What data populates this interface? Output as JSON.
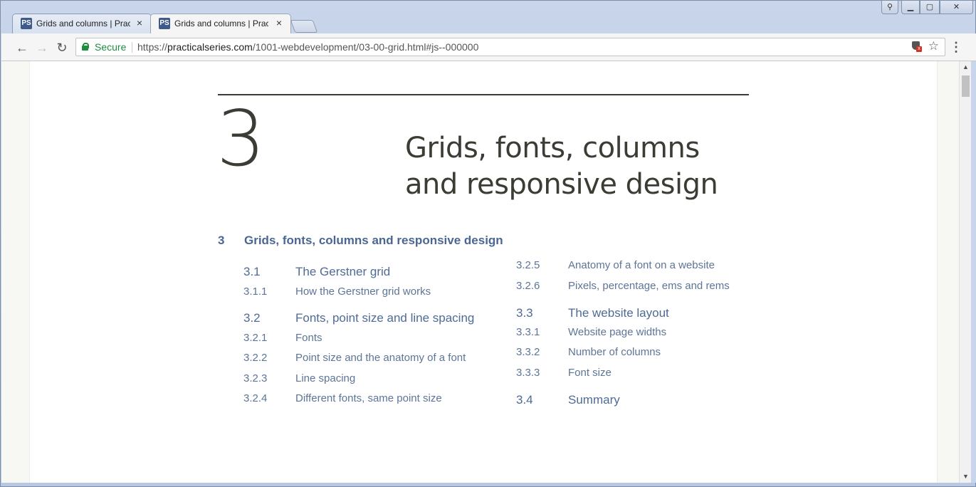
{
  "tabs": [
    {
      "favicon": "PS",
      "title": "Grids and columns | Practical Series",
      "close": "×"
    },
    {
      "favicon": "PS",
      "title": "Grids and columns | Practical Series",
      "close": "×"
    }
  ],
  "window_controls": {
    "user": "⚲",
    "minimize": "▁",
    "maximize": "▢",
    "close": "✕"
  },
  "toolbar": {
    "back": "←",
    "forward": "→",
    "reload": "↻",
    "secure_label": "Secure",
    "url_scheme": "https://",
    "url_host": "practicalseries.com",
    "url_path": "/1001-webdevelopment/03-00-grid.html#js--000000",
    "star": "☆",
    "menu": "⋮"
  },
  "chapter": {
    "number": "3",
    "title": "Grids, fonts, columns and responsive design"
  },
  "toc_heading": {
    "num": "3",
    "label": "Grids, fonts, columns and responsive design"
  },
  "toc_left": [
    {
      "num": "3.1",
      "label": "The Gerstner grid",
      "level": "section"
    },
    {
      "num": "3.1.1",
      "label": "How the Gerstner grid works",
      "level": "sub"
    },
    {
      "num": "3.2",
      "label": "Fonts, point size and line spacing",
      "level": "section"
    },
    {
      "num": "3.2.1",
      "label": "Fonts",
      "level": "sub"
    },
    {
      "num": "3.2.2",
      "label": "Point size and the anatomy of a font",
      "level": "sub"
    },
    {
      "num": "3.2.3",
      "label": "Line spacing",
      "level": "sub"
    },
    {
      "num": "3.2.4",
      "label": "Different fonts, same point size",
      "level": "sub"
    }
  ],
  "toc_right": [
    {
      "num": "3.2.5",
      "label": "Anatomy of a font on a website",
      "level": "sub"
    },
    {
      "num": "3.2.6",
      "label": "Pixels, percentage, ems and rems",
      "level": "sub"
    },
    {
      "num": "3.3",
      "label": "The website layout",
      "level": "section"
    },
    {
      "num": "3.3.1",
      "label": "Website page widths",
      "level": "sub"
    },
    {
      "num": "3.3.2",
      "label": "Number of columns",
      "level": "sub"
    },
    {
      "num": "3.3.3",
      "label": "Font size",
      "level": "sub"
    },
    {
      "num": "3.4",
      "label": "Summary",
      "level": "section"
    }
  ],
  "scrollbar": {
    "up": "▲",
    "down": "▼"
  }
}
